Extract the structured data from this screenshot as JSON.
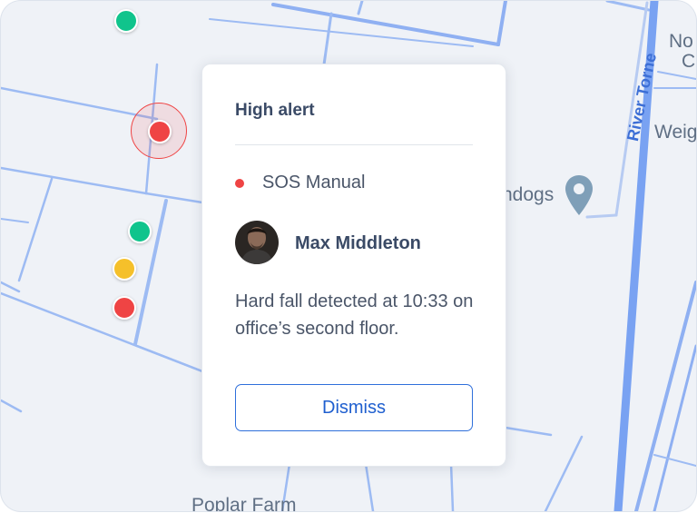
{
  "colors": {
    "map_background": "#eff2f7",
    "road": "#8fb0f2",
    "major_road": "#6f9af0",
    "status_red": "#ef4444",
    "status_green": "#10c48c",
    "status_yellow": "#f5c02a",
    "accent_blue": "#2f6fdb",
    "place_pin": "#7f9fb8"
  },
  "map": {
    "labels": {
      "road": "River Torne",
      "place_top_right_1": "No",
      "place_top_right_2": "Co",
      "place_right": "Weig",
      "place_mid": "ndogs",
      "place_bottom": "Poplar Farm"
    },
    "pins": [
      {
        "status": "green"
      },
      {
        "status": "red",
        "active": true
      },
      {
        "status": "green"
      },
      {
        "status": "yellow"
      },
      {
        "status": "red"
      }
    ],
    "place_marker_icon": "map-pin-icon"
  },
  "alert": {
    "title": "High alert",
    "status_label": "SOS Manual",
    "user_name": "Max Middleton",
    "avatar_icon": "user-avatar",
    "message": "Hard fall detected at 10:33 on office’s second floor.",
    "dismiss_label": "Dismiss"
  }
}
